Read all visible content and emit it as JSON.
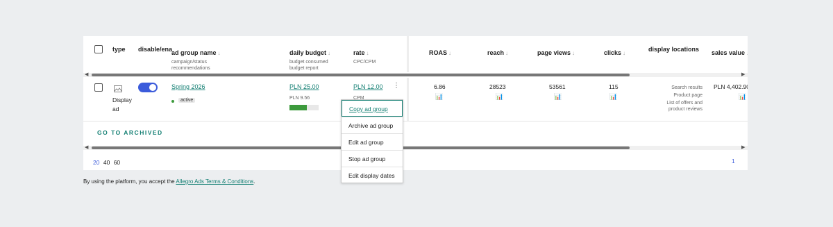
{
  "table": {
    "headers": {
      "type": "type",
      "disable_enable": "disable/ena",
      "ad_group_name": "ad group name",
      "ad_group_name_sub1": "campaign/status",
      "ad_group_name_sub2": "recommendations",
      "daily_budget": "daily budget",
      "daily_budget_sub1": "budget consumed",
      "daily_budget_sub2": "budget report",
      "rate": "rate",
      "rate_sub": "CPC/CPM",
      "roas": "ROAS",
      "reach": "reach",
      "page_views": "page views",
      "clicks": "clicks",
      "display_locations": "display locations",
      "sales_value": "sales value"
    },
    "sort_arrow": "↓",
    "row": {
      "type_line1": "Display",
      "type_line2": "ad",
      "toggle_on": true,
      "ad_group_name": "Spring 2026",
      "status": "active",
      "daily_budget": "PLN 25.00",
      "budget_consumed": "PLN 9.56",
      "budget_consumed_fraction": 0.6,
      "rate": "PLN 12.00",
      "rate_type": "CPM",
      "roas": "6.86",
      "reach": "28523",
      "page_views": "53561",
      "clicks": "115",
      "display_locations": [
        "Search results",
        "Product page",
        "List of offers and",
        "product reviews"
      ],
      "sales_value": "PLN 4,402.90"
    },
    "go_to_archived": "GO TO ARCHIVED"
  },
  "context_menu": {
    "items": [
      "Copy ad group",
      "Archive ad group",
      "Edit ad group",
      "Stop ad group",
      "Edit display dates"
    ]
  },
  "pagination": {
    "page_sizes": [
      "20",
      "40",
      "60"
    ],
    "current_page": "1"
  },
  "footer": {
    "text_before": "By using the platform, you accept the ",
    "link": "Allegro Ads Terms & Conditions",
    "text_after": "."
  },
  "colors": {
    "accent": "#137f73",
    "toggle": "#3b5bdb",
    "budget_bar": "#3c9a3c"
  }
}
